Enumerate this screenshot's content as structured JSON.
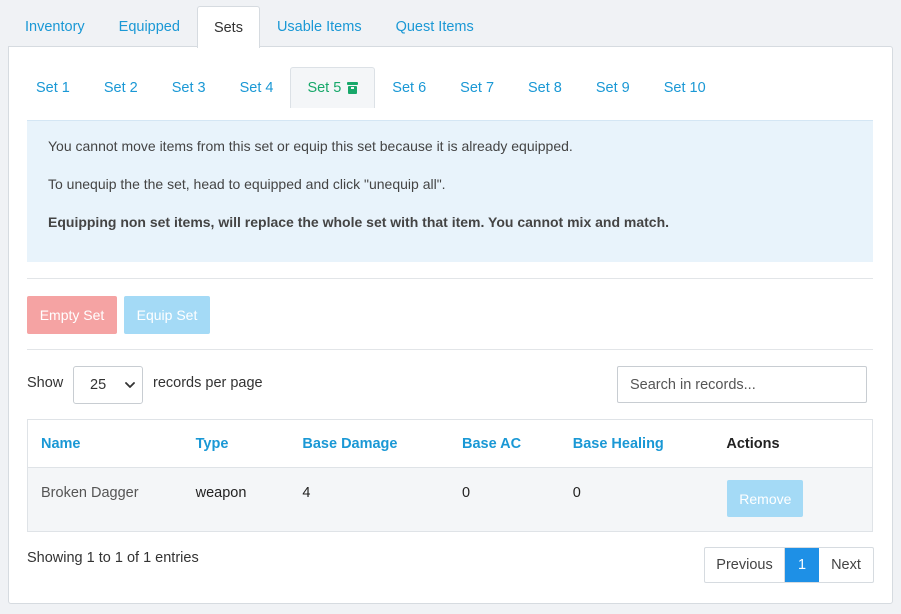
{
  "top_tabs": [
    {
      "label": "Inventory"
    },
    {
      "label": "Equipped"
    },
    {
      "label": "Sets"
    },
    {
      "label": "Usable Items"
    },
    {
      "label": "Quest Items"
    }
  ],
  "active_top_tab": "Sets",
  "set_tabs": [
    {
      "label": "Set 1"
    },
    {
      "label": "Set 2"
    },
    {
      "label": "Set 3"
    },
    {
      "label": "Set 4"
    },
    {
      "label": "Set 5"
    },
    {
      "label": "Set 6"
    },
    {
      "label": "Set 7"
    },
    {
      "label": "Set 8"
    },
    {
      "label": "Set 9"
    },
    {
      "label": "Set 10"
    }
  ],
  "active_set_tab": "Set 5",
  "active_set_icon": "equipped-icon",
  "info": {
    "line1": "You cannot move items from this set or equip this set because it is already equipped.",
    "line2": "To unequip the the set, head to equipped and click \"unequip all\".",
    "line3": "Equipping non set items, will replace the whole set with that item. You cannot mix and match."
  },
  "actions": {
    "empty_label": "Empty Set",
    "equip_label": "Equip Set"
  },
  "controls": {
    "show_label": "Show",
    "per_page_value": "25",
    "records_label": "records per page",
    "search_placeholder": "Search in records..."
  },
  "table": {
    "headers": {
      "name": "Name",
      "type": "Type",
      "base_damage": "Base Damage",
      "base_ac": "Base AC",
      "base_healing": "Base Healing",
      "actions": "Actions"
    },
    "rows": [
      {
        "name": "Broken Dagger",
        "type": "weapon",
        "base_damage": "4",
        "base_ac": "0",
        "base_healing": "0",
        "action_label": "Remove"
      }
    ]
  },
  "footer": {
    "showing": "Showing 1 to 1 of 1 entries",
    "prev_label": "Previous",
    "page": "1",
    "next_label": "Next"
  },
  "colors": {
    "link": "#1a98d5",
    "active_set": "#17a86a",
    "danger_light": "#f5a3a3",
    "info_light": "#a4daf6",
    "info_bg": "#e8f3fb",
    "pager_active": "#1e90e6"
  }
}
